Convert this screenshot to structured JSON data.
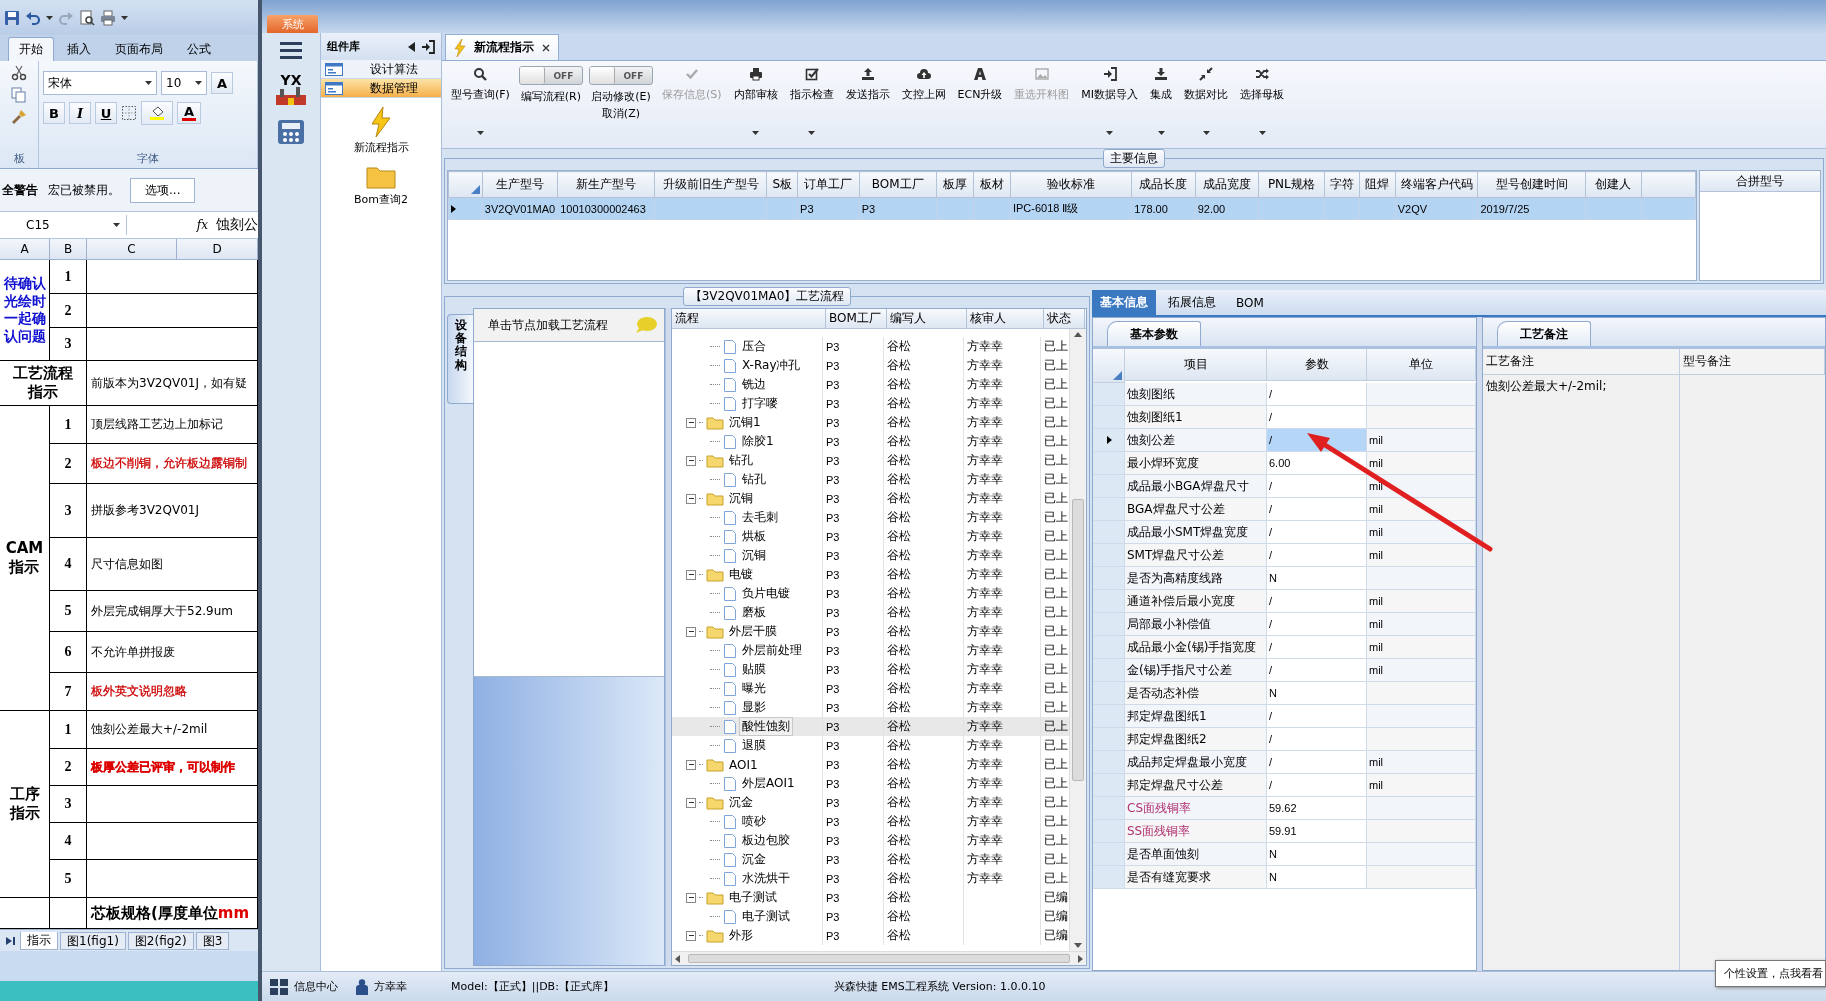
{
  "excel": {
    "ribbon_tabs": [
      {
        "label": "开始",
        "selected": true
      },
      {
        "label": "插入",
        "selected": false
      },
      {
        "label": "页面布局",
        "selected": false
      },
      {
        "label": "公式",
        "selected": false
      }
    ],
    "clipboard_group": "板",
    "font_name": "宋体",
    "font_size": "10",
    "grow_font_button": "A",
    "format_buttons": [
      "B",
      "I",
      "U"
    ],
    "font_color_button": "A",
    "font_group": "字体",
    "security_bar": {
      "title": "全警告",
      "message": "宏已被禁用。",
      "button": "选项..."
    },
    "name_box": "C15",
    "function_label": "fx",
    "formula": "蚀刻公",
    "columns": [
      "A",
      "B",
      "C",
      "D"
    ],
    "sections": [
      {
        "kind": "pending",
        "title_lines": [
          "待确认",
          "光绘时",
          "一起确",
          "认问题"
        ],
        "rows": [
          {
            "number": "1"
          },
          {
            "number": "2"
          },
          {
            "number": "3"
          }
        ]
      },
      {
        "kind": "heading",
        "title_lines": [
          "工艺流程",
          "指示"
        ],
        "text": "前版本为3V2QV01J，如有疑"
      },
      {
        "kind": "heading",
        "title_lines": [
          "CAM",
          "指示"
        ],
        "rows": [
          {
            "number": "1",
            "text": "顶层线路工艺边上加标记",
            "bold": false
          },
          {
            "number": "2",
            "text": "板边不削铜，允许板边露铜制",
            "color": "#cc0000",
            "bold": false
          },
          {
            "number": "3",
            "text": "拼版参考3V2QV01J",
            "bold": false
          },
          {
            "number": "4",
            "text": "尺寸信息如图",
            "bold": false
          },
          {
            "number": "5",
            "text": "外层完成铜厚大于52.9um",
            "bold": false
          },
          {
            "number": "6",
            "text": "不允许单拼报废",
            "bold": false
          },
          {
            "number": "7",
            "text": "板外英文说明忽略",
            "color": "#cc0000",
            "bold": false
          }
        ]
      },
      {
        "kind": "heading",
        "title_lines": [
          "工序",
          "指示"
        ],
        "rows": [
          {
            "number": "1",
            "text": "蚀刻公差最大+/-2mil",
            "bold": false
          },
          {
            "number": "2",
            "text": "板厚公差已评审，可以制作",
            "color": "#dd0000",
            "bold": true
          },
          {
            "number": "3"
          },
          {
            "number": "4"
          },
          {
            "number": "5"
          }
        ]
      },
      {
        "kind": "spec",
        "rows": [
          {
            "text": "芯板规格(厚度单位",
            "unit": "mm"
          }
        ]
      }
    ],
    "sheet_tabs": [
      {
        "label": "指示",
        "selected": true
      },
      {
        "label": "图1(fig1)",
        "selected": false
      },
      {
        "label": "图2(fig2)",
        "selected": false
      },
      {
        "label": "图3",
        "selected": false
      }
    ]
  },
  "app": {
    "system_tab": "系统",
    "logo_text": "YX",
    "component_panel": {
      "title": "组件库",
      "items": [
        {
          "label": "设计算法",
          "selected": false
        },
        {
          "label": "数据管理",
          "selected": true
        }
      ],
      "launchers": [
        "新流程指示",
        "Bom查询2"
      ]
    },
    "document_tabs": [
      {
        "label": "新流程指示",
        "selected": true
      }
    ],
    "toolbar": [
      {
        "kind": "button",
        "label": "型号查询(F)",
        "dropdown": true,
        "disabled": false
      },
      {
        "kind": "toggle",
        "switch_text": "OFF",
        "on": false,
        "label": "编写流程(R)"
      },
      {
        "kind": "toggle",
        "switch_text": "OFF",
        "on": false,
        "label": "启动修改(E)",
        "sub_label": "取消(Z)"
      },
      {
        "kind": "button",
        "label": "保存信息(S)",
        "dropdown": false,
        "disabled": true
      },
      {
        "kind": "button",
        "label": "内部审核",
        "dropdown": true,
        "disabled": false
      },
      {
        "kind": "button",
        "label": "指示检查",
        "dropdown": true,
        "disabled": false
      },
      {
        "kind": "button",
        "label": "发送指示",
        "dropdown": false,
        "disabled": false
      },
      {
        "kind": "button",
        "label": "文控上网",
        "dropdown": false,
        "disabled": false
      },
      {
        "kind": "button",
        "label": "ECN升级",
        "dropdown": false,
        "disabled": false
      },
      {
        "kind": "button",
        "label": "重选开料图",
        "dropdown": false,
        "disabled": true
      },
      {
        "kind": "button",
        "label": "MI数据导入",
        "dropdown": true,
        "disabled": false
      },
      {
        "kind": "button",
        "label": "集成",
        "dropdown": true,
        "disabled": false
      },
      {
        "kind": "button",
        "label": "数据对比",
        "dropdown": true,
        "disabled": false
      },
      {
        "kind": "button",
        "label": "选择母板",
        "dropdown": true,
        "disabled": false
      }
    ],
    "main_info": {
      "title": "主要信息",
      "columns": [
        "生产型号",
        "新生产型号",
        "升级前旧生产型号",
        "S板",
        "订单工厂",
        "BOM工厂",
        "板厚",
        "板材",
        "验收标准",
        "成品长度",
        "成品宽度",
        "PNL规格",
        "字符",
        "阻焊",
        "终端客户代码",
        "型号创建时间",
        "创建人"
      ],
      "rows": [
        {
          "selected": true,
          "cells": [
            "3V2QV01MA0",
            "10010300002463",
            null,
            null,
            "P3",
            "P3",
            null,
            null,
            "IPC-6018 Ⅱ级",
            "178.00",
            "92.00",
            null,
            null,
            null,
            "V2QV",
            "2019/7/25",
            null
          ]
        }
      ]
    },
    "merged_models": {
      "title": "合拼型号"
    },
    "process_flow": {
      "title": "【3V2QV01MA0】工艺流程",
      "side_tab": "设备结构",
      "hint": "单击节点加载工艺流程",
      "columns": [
        "流程",
        "BOM工厂",
        "编写人",
        "核审人",
        "状态"
      ],
      "tree": [
        {
          "kind": "file",
          "label": "压合",
          "bom": "P3",
          "writer": "谷松",
          "reviewer": "方幸幸",
          "status": "已上",
          "selected": false
        },
        {
          "kind": "file",
          "label": "X-Ray冲孔",
          "bom": "P3",
          "writer": "谷松",
          "reviewer": "方幸幸",
          "status": "已上",
          "selected": false
        },
        {
          "kind": "file",
          "label": "铣边",
          "bom": "P3",
          "writer": "谷松",
          "reviewer": "方幸幸",
          "status": "已上",
          "selected": false
        },
        {
          "kind": "file",
          "label": "打字嘜",
          "bom": "P3",
          "writer": "谷松",
          "reviewer": "方幸幸",
          "status": "已上",
          "selected": false
        },
        {
          "kind": "folder",
          "label": "沉铜1",
          "bom": "P3",
          "writer": "谷松",
          "reviewer": "方幸幸",
          "status": "已上",
          "selected": false,
          "expanded": true,
          "children": [
            {
              "kind": "file",
              "label": "除胶1",
              "bom": "P3",
              "writer": "谷松",
              "reviewer": "方幸幸",
              "status": "已上",
              "selected": false
            }
          ]
        },
        {
          "kind": "folder",
          "label": "钻孔",
          "bom": "P3",
          "writer": "谷松",
          "reviewer": "方幸幸",
          "status": "已上",
          "selected": false,
          "expanded": true,
          "children": [
            {
              "kind": "file",
              "label": "钻孔",
              "bom": "P3",
              "writer": "谷松",
              "reviewer": "方幸幸",
              "status": "已上",
              "selected": false
            }
          ]
        },
        {
          "kind": "folder",
          "label": "沉铜",
          "bom": "P3",
          "writer": "谷松",
          "reviewer": "方幸幸",
          "status": "已上",
          "selected": false,
          "expanded": true,
          "children": [
            {
              "kind": "file",
              "label": "去毛刺",
              "bom": "P3",
              "writer": "谷松",
              "reviewer": "方幸幸",
              "status": "已上",
              "selected": false
            },
            {
              "kind": "file",
              "label": "烘板",
              "bom": "P3",
              "writer": "谷松",
              "reviewer": "方幸幸",
              "status": "已上",
              "selected": false
            },
            {
              "kind": "file",
              "label": "沉铜",
              "bom": "P3",
              "writer": "谷松",
              "reviewer": "方幸幸",
              "status": "已上",
              "selected": false
            }
          ]
        },
        {
          "kind": "folder",
          "label": "电镀",
          "bom": "P3",
          "writer": "谷松",
          "reviewer": "方幸幸",
          "status": "已上",
          "selected": false,
          "expanded": true,
          "children": [
            {
              "kind": "file",
              "label": "负片电镀",
              "bom": "P3",
              "writer": "谷松",
              "reviewer": "方幸幸",
              "status": "已上",
              "selected": false
            },
            {
              "kind": "file",
              "label": "磨板",
              "bom": "P3",
              "writer": "谷松",
              "reviewer": "方幸幸",
              "status": "已上",
              "selected": false
            }
          ]
        },
        {
          "kind": "folder",
          "label": "外层干膜",
          "bom": "P3",
          "writer": "谷松",
          "reviewer": "方幸幸",
          "status": "已上",
          "selected": false,
          "expanded": true,
          "children": [
            {
              "kind": "file",
              "label": "外层前处理",
              "bom": "P3",
              "writer": "谷松",
              "reviewer": "方幸幸",
              "status": "已上",
              "selected": false
            },
            {
              "kind": "file",
              "label": "贴膜",
              "bom": "P3",
              "writer": "谷松",
              "reviewer": "方幸幸",
              "status": "已上",
              "selected": false
            },
            {
              "kind": "file",
              "label": "曝光",
              "bom": "P3",
              "writer": "谷松",
              "reviewer": "方幸幸",
              "status": "已上",
              "selected": false
            },
            {
              "kind": "file",
              "label": "显影",
              "bom": "P3",
              "writer": "谷松",
              "reviewer": "方幸幸",
              "status": "已上",
              "selected": false
            },
            {
              "kind": "file",
              "label": "酸性蚀刻",
              "bom": "P3",
              "writer": "谷松",
              "reviewer": "方幸幸",
              "status": "已上",
              "selected": true
            },
            {
              "kind": "file",
              "label": "退膜",
              "bom": "P3",
              "writer": "谷松",
              "reviewer": "方幸幸",
              "status": "已上",
              "selected": false
            }
          ]
        },
        {
          "kind": "folder",
          "label": "AOI1",
          "bom": "P3",
          "writer": "谷松",
          "reviewer": "方幸幸",
          "status": "已上",
          "selected": false,
          "expanded": true,
          "children": [
            {
              "kind": "file",
              "label": "外层AOI1",
              "bom": "P3",
              "writer": "谷松",
              "reviewer": "方幸幸",
              "status": "已上",
              "selected": false
            }
          ]
        },
        {
          "kind": "folder",
          "label": "沉金",
          "bom": "P3",
          "writer": "谷松",
          "reviewer": "方幸幸",
          "status": "已上",
          "selected": false,
          "expanded": true,
          "children": [
            {
              "kind": "file",
              "label": "喷砂",
              "bom": "P3",
              "writer": "谷松",
              "reviewer": "方幸幸",
              "status": "已上",
              "selected": false
            },
            {
              "kind": "file",
              "label": "板边包胶",
              "bom": "P3",
              "writer": "谷松",
              "reviewer": "方幸幸",
              "status": "已上",
              "selected": false
            },
            {
              "kind": "file",
              "label": "沉金",
              "bom": "P3",
              "writer": "谷松",
              "reviewer": "方幸幸",
              "status": "已上",
              "selected": false
            },
            {
              "kind": "file",
              "label": "水洗烘干",
              "bom": "P3",
              "writer": "谷松",
              "reviewer": "方幸幸",
              "status": "已上",
              "selected": false
            }
          ]
        },
        {
          "kind": "folder",
          "label": "电子测试",
          "bom": "P3",
          "writer": "谷松",
          "status": "已编",
          "selected": false,
          "expanded": true,
          "children": [
            {
              "kind": "file",
              "label": "电子测试",
              "bom": "P3",
              "writer": "谷松",
              "status": "已编",
              "selected": false
            }
          ]
        },
        {
          "kind": "folder",
          "label": "外形",
          "bom": "P3",
          "writer": "谷松",
          "status": "已编",
          "selected": false,
          "expanded": true
        }
      ]
    },
    "details": {
      "tabs": [
        {
          "label": "基本信息",
          "selected": true
        },
        {
          "label": "拓展信息",
          "selected": false
        },
        {
          "label": "BOM",
          "selected": false
        }
      ],
      "basic_params": {
        "title": "基本参数",
        "columns": [
          "项目",
          "参数",
          "单位"
        ],
        "rows": [
          {
            "name": "蚀刻图纸",
            "value": "/",
            "selected": false
          },
          {
            "name": "蚀刻图纸1",
            "value": "/",
            "selected": false
          },
          {
            "name": "蚀刻公差",
            "value": "/",
            "unit": "mil",
            "selected": true
          },
          {
            "name": "最小焊环宽度",
            "value": "6.00",
            "unit": "mil",
            "selected": false
          },
          {
            "name": "成品最小BGA焊盘尺寸",
            "value": "/",
            "unit": "mil",
            "selected": false
          },
          {
            "name": "BGA焊盘尺寸公差",
            "value": "/",
            "unit": "mil",
            "selected": false
          },
          {
            "name": "成品最小SMT焊盘宽度",
            "value": "/",
            "unit": "mil",
            "selected": false
          },
          {
            "name": "SMT焊盘尺寸公差",
            "value": "/",
            "unit": "mil",
            "selected": false
          },
          {
            "name": "是否为高精度线路",
            "value": "N",
            "selected": false
          },
          {
            "name": "通道补偿后最小宽度",
            "value": "/",
            "unit": "mil",
            "selected": false
          },
          {
            "name": "局部最小补偿值",
            "value": "/",
            "unit": "mil",
            "selected": false
          },
          {
            "name": "成品最小金(锡)手指宽度",
            "value": "/",
            "unit": "mil",
            "selected": false
          },
          {
            "name": "金(锡)手指尺寸公差",
            "value": "/",
            "unit": "mil",
            "selected": false
          },
          {
            "name": "是否动态补偿",
            "value": "N",
            "selected": false
          },
          {
            "name": "邦定焊盘图纸1",
            "value": "/",
            "selected": false
          },
          {
            "name": "邦定焊盘图纸2",
            "value": "/",
            "selected": false
          },
          {
            "name": "成品邦定焊盘最小宽度",
            "value": "/",
            "unit": "mil",
            "selected": false
          },
          {
            "name": "邦定焊盘尺寸公差",
            "value": "/",
            "unit": "mil",
            "selected": false
          },
          {
            "name": "CS面残铜率",
            "value": "59.62",
            "color": "#b03070",
            "selected": false
          },
          {
            "name": "SS面残铜率",
            "value": "59.91",
            "color": "#b03070",
            "selected": false
          },
          {
            "name": "是否单面蚀刻",
            "value": "N",
            "selected": false
          },
          {
            "name": "是否有缝宽要求",
            "value": "N",
            "selected": false
          }
        ]
      },
      "process_notes": {
        "title": "工艺备注",
        "columns": [
          "工艺备注",
          "型号备注"
        ],
        "note": "蚀刻公差最大+/-2mil;"
      }
    },
    "status_bar": {
      "info_center": "信息中心",
      "user": "方幸幸",
      "model": "Model:【正式】||DB:【正式库】",
      "product": "兴森快捷 EMS工程系统 Version: 1.0.0.10"
    },
    "tooltip": "个性设置，点我看看"
  }
}
